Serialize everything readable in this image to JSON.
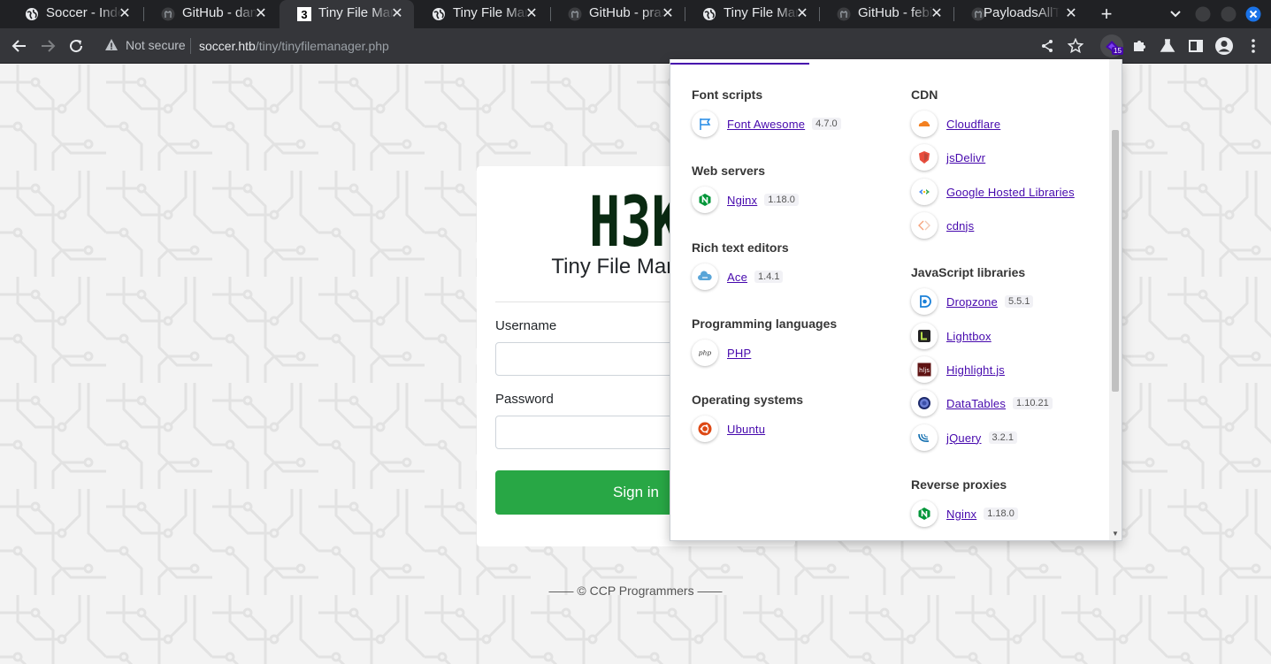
{
  "browser": {
    "tabs": [
      {
        "title": "Soccer - Inde",
        "favicon": "globe-icon"
      },
      {
        "title": "GitHub - dan",
        "favicon": "github-icon"
      },
      {
        "title": "Tiny File Man",
        "favicon": "h3k-icon",
        "active": true
      },
      {
        "title": "Tiny File Man",
        "favicon": "globe-icon"
      },
      {
        "title": "GitHub - pras",
        "favicon": "github-icon"
      },
      {
        "title": "Tiny File Man",
        "favicon": "globe-icon"
      },
      {
        "title": "GitHub - febi",
        "favicon": "github-icon"
      },
      {
        "title": "PayloadsAllTh",
        "favicon": "github-icon"
      }
    ],
    "new_tab": "+",
    "security_label": "Not secure",
    "url_host": "soccer.htb",
    "url_path": "/tiny/tinyfilemanager.php",
    "extension_badge": "15"
  },
  "login": {
    "logo_text": "H3K",
    "title": "Tiny File Manager",
    "username_label": "Username",
    "password_label": "Password",
    "signin_label": "Sign in",
    "footer": "—— © CCP Programmers ——"
  },
  "wappalyzer": {
    "left": [
      {
        "category": "Font scripts",
        "items": [
          {
            "name": "Font Awesome",
            "version": "4.7.0",
            "icon": "flag-icon"
          }
        ]
      },
      {
        "category": "Web servers",
        "items": [
          {
            "name": "Nginx",
            "version": "1.18.0",
            "icon": "nginx-icon"
          }
        ]
      },
      {
        "category": "Rich text editors",
        "items": [
          {
            "name": "Ace",
            "version": "1.4.1",
            "icon": "cloud9-icon"
          }
        ]
      },
      {
        "category": "Programming languages",
        "items": [
          {
            "name": "PHP",
            "version": "",
            "icon": "php-icon"
          }
        ]
      },
      {
        "category": "Operating systems",
        "items": [
          {
            "name": "Ubuntu",
            "version": "",
            "icon": "ubuntu-icon"
          }
        ]
      }
    ],
    "right": [
      {
        "category": "CDN",
        "items": [
          {
            "name": "Cloudflare",
            "version": "",
            "icon": "cloudflare-icon"
          },
          {
            "name": "jsDelivr",
            "version": "",
            "icon": "jsdelivr-icon"
          },
          {
            "name": "Google Hosted Libraries",
            "version": "",
            "icon": "google-icon"
          },
          {
            "name": "cdnjs",
            "version": "",
            "icon": "cdnjs-icon"
          }
        ]
      },
      {
        "category": "JavaScript libraries",
        "items": [
          {
            "name": "Dropzone",
            "version": "5.5.1",
            "icon": "dropzone-icon"
          },
          {
            "name": "Lightbox",
            "version": "",
            "icon": "lightbox-icon"
          },
          {
            "name": "Highlight.js",
            "version": "",
            "icon": "hljs-icon"
          },
          {
            "name": "DataTables",
            "version": "1.10.21",
            "icon": "datatables-icon"
          },
          {
            "name": "jQuery",
            "version": "3.2.1",
            "icon": "jquery-icon"
          }
        ]
      },
      {
        "category": "Reverse proxies",
        "items": [
          {
            "name": "Nginx",
            "version": "1.18.0",
            "icon": "nginx-icon"
          }
        ]
      }
    ]
  },
  "colors": {
    "accent": "#4608ad",
    "signin": "#28a745",
    "logo": "#0a2a12"
  }
}
